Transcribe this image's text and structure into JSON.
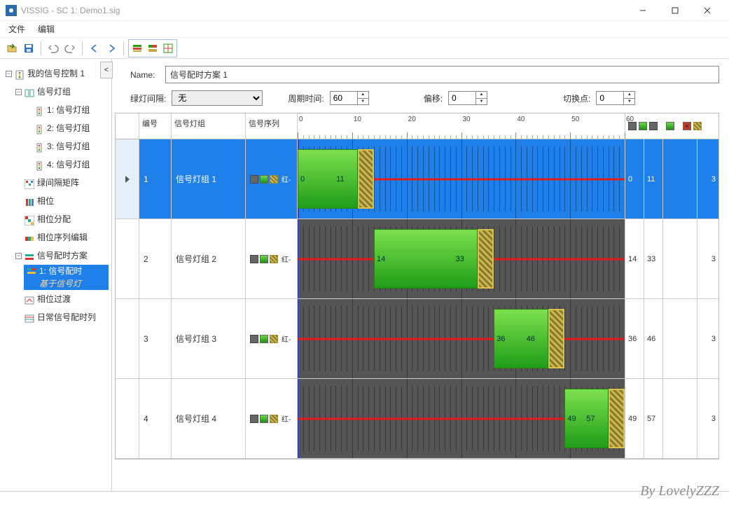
{
  "title": "VISSIG - SC 1: Demo1.sig",
  "menu": {
    "file": "文件",
    "edit": "编辑"
  },
  "toolbar": {
    "group_selected": true
  },
  "tree": {
    "root": "我的信号控制 1",
    "signal_group": "信号灯组",
    "sg_items": [
      "1: 信号灯组",
      "2: 信号灯组",
      "3: 信号灯组",
      "4: 信号灯组"
    ],
    "intergreen": "绿间隔矩阵",
    "phase": "相位",
    "phase_alloc": "相位分配",
    "phase_seq_edit": "相位序列编辑",
    "timing_plan": "信号配时方案",
    "timing_plan_item_line1": "1: 信号配时",
    "timing_plan_item_line2": "基于信号灯",
    "phase_trans": "相位过渡",
    "daily": "日常信号配时列"
  },
  "collapse_btn": "<",
  "name_label": "Name:",
  "name_value": "信号配时方案 1",
  "params": {
    "green_interval_label": "绿灯间隔:",
    "green_interval_value": "无",
    "cycle_label": "周期时间:",
    "cycle_value": "60",
    "offset_label": "偏移:",
    "offset_value": "0",
    "switch_label": "切换点:",
    "switch_value": "0"
  },
  "headers": {
    "num": "编号",
    "group": "信号灯组",
    "seq": "信号序列"
  },
  "axis_max": 60,
  "rows": [
    {
      "num": "1",
      "group": "信号灯组 1",
      "seq_suffix": "红-",
      "green_start": 0,
      "green_end": 11,
      "amber_end": 14,
      "s1": "0",
      "s2": "11",
      "s3": "3",
      "selected": true
    },
    {
      "num": "2",
      "group": "信号灯组 2",
      "seq_suffix": "红-",
      "green_start": 14,
      "green_end": 33,
      "amber_end": 36,
      "s1": "14",
      "s2": "33",
      "s3": "3",
      "selected": false
    },
    {
      "num": "3",
      "group": "信号灯组 3",
      "seq_suffix": "红-",
      "green_start": 36,
      "green_end": 46,
      "amber_end": 49,
      "s1": "36",
      "s2": "46",
      "s3": "3",
      "selected": false
    },
    {
      "num": "4",
      "group": "信号灯组 4",
      "seq_suffix": "红-",
      "green_start": 49,
      "green_end": 57,
      "amber_end": 60,
      "s1": "49",
      "s2": "57",
      "s3": "3",
      "selected": false
    }
  ],
  "watermark": "By LovelyZZZ"
}
